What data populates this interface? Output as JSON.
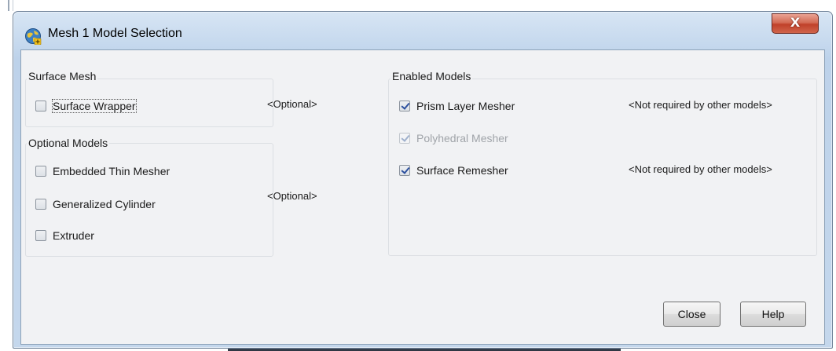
{
  "window": {
    "title": "Mesh 1 Model Selection",
    "close_glyph": "X"
  },
  "surface_mesh": {
    "label": "Surface Mesh",
    "items": [
      {
        "label": "Surface Wrapper",
        "checked": false,
        "enabled": true
      }
    ],
    "note": "<Optional>"
  },
  "optional_models": {
    "label": "Optional Models",
    "items": [
      {
        "label": "Embedded Thin Mesher",
        "checked": false,
        "enabled": true
      },
      {
        "label": "Generalized Cylinder",
        "checked": false,
        "enabled": true
      },
      {
        "label": "Extruder",
        "checked": false,
        "enabled": true
      }
    ],
    "note": "<Optional>"
  },
  "enabled_models": {
    "label": "Enabled Models",
    "items": [
      {
        "label": "Prism Layer Mesher",
        "checked": true,
        "enabled": true,
        "note": "<Not required by other models>"
      },
      {
        "label": "Polyhedral Mesher",
        "checked": true,
        "enabled": false,
        "note": ""
      },
      {
        "label": "Surface Remesher",
        "checked": true,
        "enabled": true,
        "note": "<Not required by other models>"
      }
    ]
  },
  "buttons": {
    "close": "Close",
    "help": "Help"
  }
}
